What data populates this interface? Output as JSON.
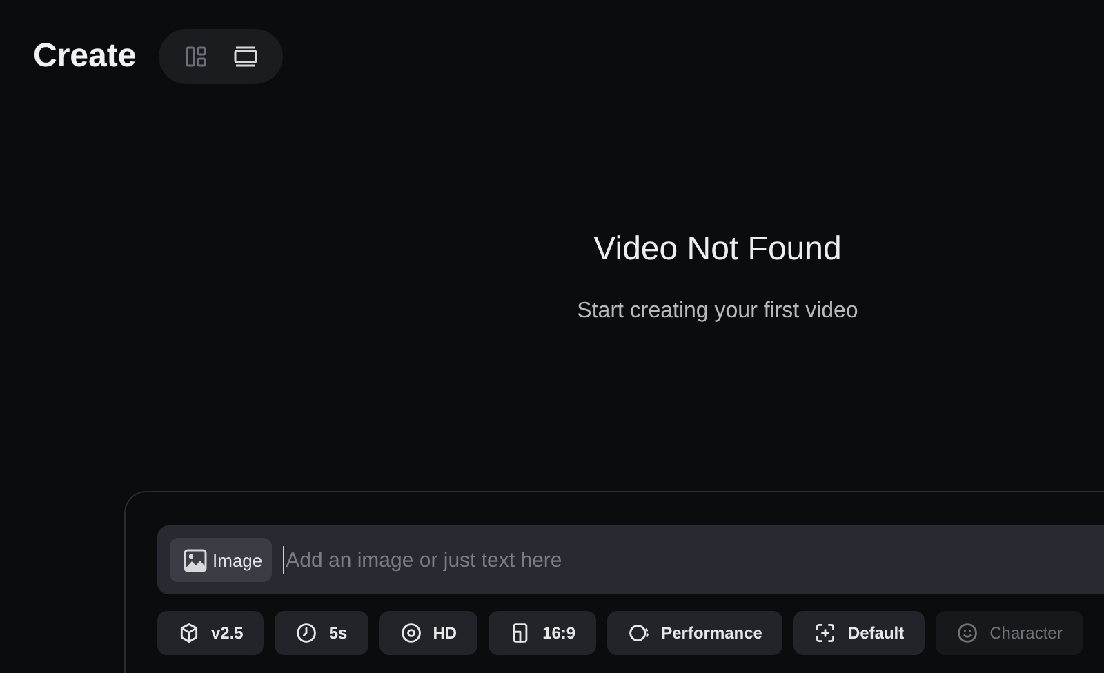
{
  "header": {
    "title": "Create",
    "view_toggle": [
      {
        "kind": "grid",
        "selected": false
      },
      {
        "kind": "list",
        "selected": true
      }
    ]
  },
  "empty_state": {
    "title": "Video Not Found",
    "subtitle": "Start creating your first video"
  },
  "composer": {
    "image_button": "Image",
    "prompt": {
      "placeholder": "Add an image or just text here"
    },
    "options": [
      {
        "kind": "cube",
        "label": "v2.5",
        "disabled": false
      },
      {
        "kind": "clock",
        "label": "5s",
        "disabled": false
      },
      {
        "kind": "eye",
        "label": "HD",
        "disabled": false
      },
      {
        "kind": "ratio",
        "label": "16:9",
        "disabled": false
      },
      {
        "kind": "motion",
        "label": "Performance",
        "disabled": false
      },
      {
        "kind": "focus",
        "label": "Default",
        "disabled": false
      },
      {
        "kind": "face",
        "label": "Character",
        "disabled": true
      }
    ]
  }
}
